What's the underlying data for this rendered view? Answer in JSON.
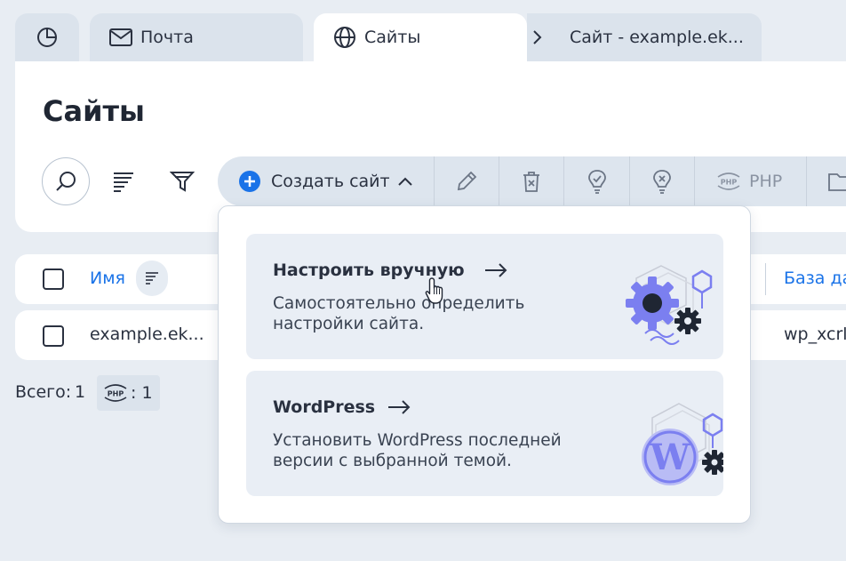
{
  "tabs": {
    "mail": "Почта",
    "sites": "Сайты",
    "site_detail": "Сайт - example.ek..."
  },
  "page": {
    "title": "Сайты"
  },
  "toolbar": {
    "create_label": "Создать сайт",
    "php_label": "PHP"
  },
  "table": {
    "col_name": "Имя",
    "col_db": "База да",
    "rows": [
      {
        "name": "example.ek...",
        "db": "wp_xcrl"
      }
    ]
  },
  "footer": {
    "total_label": "Всего:",
    "total_count": "1",
    "php_count": ": 1"
  },
  "dropdown": {
    "manual": {
      "title": "Настроить вручную",
      "desc": "Самостоятельно определить настройки сайта."
    },
    "wordpress": {
      "title": "WordPress",
      "desc": "Установить WordPress последней версии с выбранной темой."
    }
  },
  "colors": {
    "accent": "#1a73e8",
    "illustration": "#7b7ff0"
  }
}
